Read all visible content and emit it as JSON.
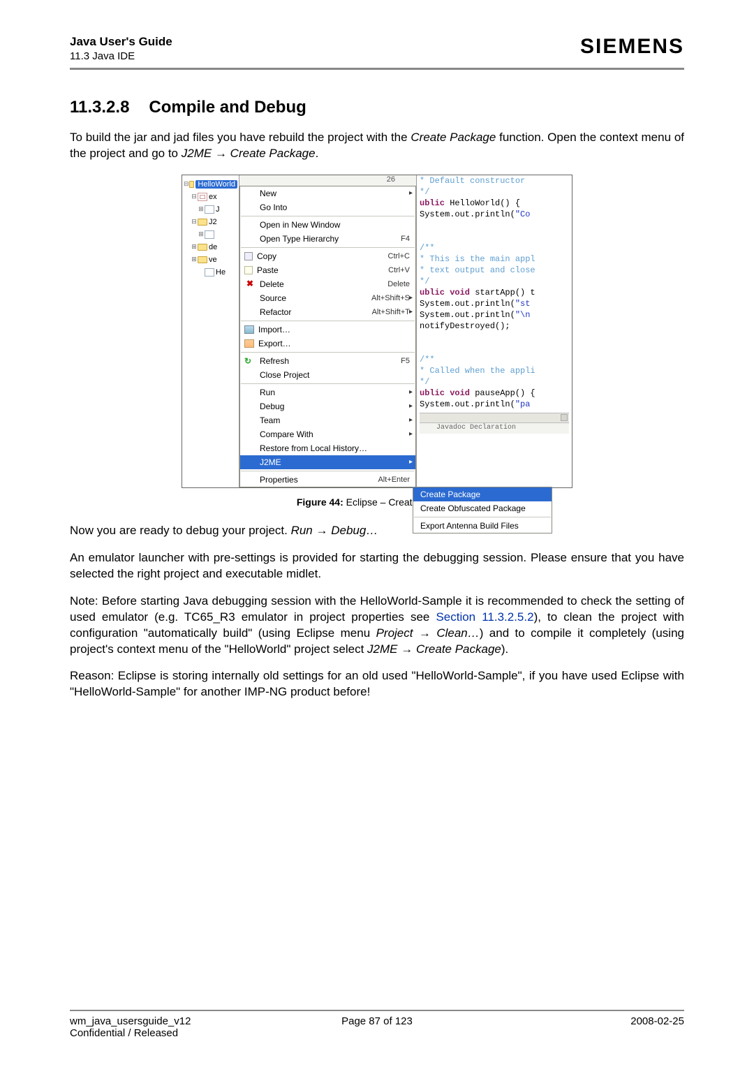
{
  "header": {
    "title": "Java User's Guide",
    "subtitle": "11.3 Java IDE",
    "brand": "SIEMENS"
  },
  "section": {
    "number": "11.3.2.8",
    "title": "Compile and Debug"
  },
  "para1_a": "To build the jar and jad files you have rebuild the project with the ",
  "para1_b": "Create Package",
  "para1_c": " function. Open the context menu of the project and go to ",
  "para1_d": "J2ME",
  "para1_e": "Create Package",
  "para1_f": ".",
  "screenshot": {
    "top_number": "26",
    "tree": {
      "project": "HelloWorld",
      "items": [
        "ex",
        "J",
        "J2",
        "de",
        "ve",
        "He"
      ]
    },
    "menu": [
      {
        "label": "New",
        "sub": true
      },
      {
        "label": "Go Into"
      },
      {
        "sep": true
      },
      {
        "label": "Open in New Window"
      },
      {
        "label": "Open Type Hierarchy",
        "accel": "F4"
      },
      {
        "sep": true
      },
      {
        "label": "Copy",
        "accel": "Ctrl+C",
        "icon": "copy"
      },
      {
        "label": "Paste",
        "accel": "Ctrl+V",
        "icon": "paste"
      },
      {
        "label": "Delete",
        "accel": "Delete",
        "icon": "delete"
      },
      {
        "label": "Source",
        "accel": "Alt+Shift+S",
        "sub": true
      },
      {
        "label": "Refactor",
        "accel": "Alt+Shift+T",
        "sub": true
      },
      {
        "sep": true
      },
      {
        "label": "Import…",
        "icon": "import"
      },
      {
        "label": "Export…",
        "icon": "export"
      },
      {
        "sep": true
      },
      {
        "label": "Refresh",
        "accel": "F5",
        "icon": "refresh"
      },
      {
        "label": "Close Project"
      },
      {
        "sep": true
      },
      {
        "label": "Run",
        "sub": true
      },
      {
        "label": "Debug",
        "sub": true
      },
      {
        "label": "Team",
        "sub": true
      },
      {
        "label": "Compare With",
        "sub": true
      },
      {
        "label": "Restore from Local History…"
      },
      {
        "label": "J2ME",
        "sub": true,
        "selected": true
      },
      {
        "sep": true
      },
      {
        "label": "Properties",
        "accel": "Alt+Enter"
      }
    ],
    "submenu": [
      {
        "label": "Create Package",
        "selected": true
      },
      {
        "label": "Create Obfuscated Package"
      },
      {
        "sep": true
      },
      {
        "label": "Export Antenna Build Files"
      }
    ],
    "code": [
      {
        "t": " * Default constructor",
        "cls": "jdoc"
      },
      {
        "t": " */",
        "cls": "jdoc"
      },
      {
        "t": "ublic HelloWorld() {",
        "kw": "ublic"
      },
      {
        "t": "  System.out.println(\"Co",
        "str": "\"Co"
      },
      {
        "t": ""
      },
      {
        "t": ""
      },
      {
        "t": "/**",
        "cls": "jdoc"
      },
      {
        "t": " * This is the main appl",
        "cls": "jdoc"
      },
      {
        "t": " * text output and close",
        "cls": "jdoc"
      },
      {
        "t": " */",
        "cls": "jdoc"
      },
      {
        "t": "ublic void startApp() t",
        "kw": "ublic void"
      },
      {
        "t": "  System.out.println(\"st",
        "str": "\"st"
      },
      {
        "t": "  System.out.println(\"\\n",
        "str": "\"\\n"
      },
      {
        "t": "  notifyDestroyed();"
      },
      {
        "t": ""
      },
      {
        "t": ""
      },
      {
        "t": "/**",
        "cls": "jdoc"
      },
      {
        "t": " * Called when the appli",
        "cls": "jdoc"
      },
      {
        "t": " */",
        "cls": "jdoc"
      },
      {
        "t": "ublic void pauseApp() {",
        "kw": "ublic void"
      },
      {
        "t": "  System.out.println(\"pa",
        "str": "\"pa"
      }
    ],
    "bottom_tabs": "Javadoc  Declaration"
  },
  "figure_caption_b": "Figure 44:",
  "figure_caption": "  Eclipse – Create package",
  "para2_a": "Now you are ready to debug your project. ",
  "para2_b": "Run",
  "para2_c": "Debug…",
  "para3": "An emulator launcher with pre-settings is provided for starting the debugging session. Please ensure that you have selected the right project and executable midlet.",
  "para4_a": "Note: Before starting Java debugging session with the HelloWorld-Sample it is recommended to check the setting of used emulator (e.g. TC65_R3 emulator in project properties see ",
  "para4_link": "Section 11.3.2.5.2",
  "para4_b": "), to clean the project with configuration \"automatically build\" (using Eclipse menu ",
  "para4_c": "Project",
  "para4_d": "Clean…",
  "para4_e": ") and to compile it completely (using project's context menu of the \"HelloWorld\" project select ",
  "para4_f": "J2ME",
  "para4_g": "Create Package",
  "para4_h": ").",
  "para5": "Reason: Eclipse is storing internally old settings for an old used \"HelloWorld-Sample\", if you have used Eclipse with \"HelloWorld-Sample\" for another IMP-NG product before!",
  "footer": {
    "left1": "wm_java_usersguide_v12",
    "left2": "Confidential / Released",
    "center": "Page 87 of 123",
    "right": "2008-02-25"
  }
}
